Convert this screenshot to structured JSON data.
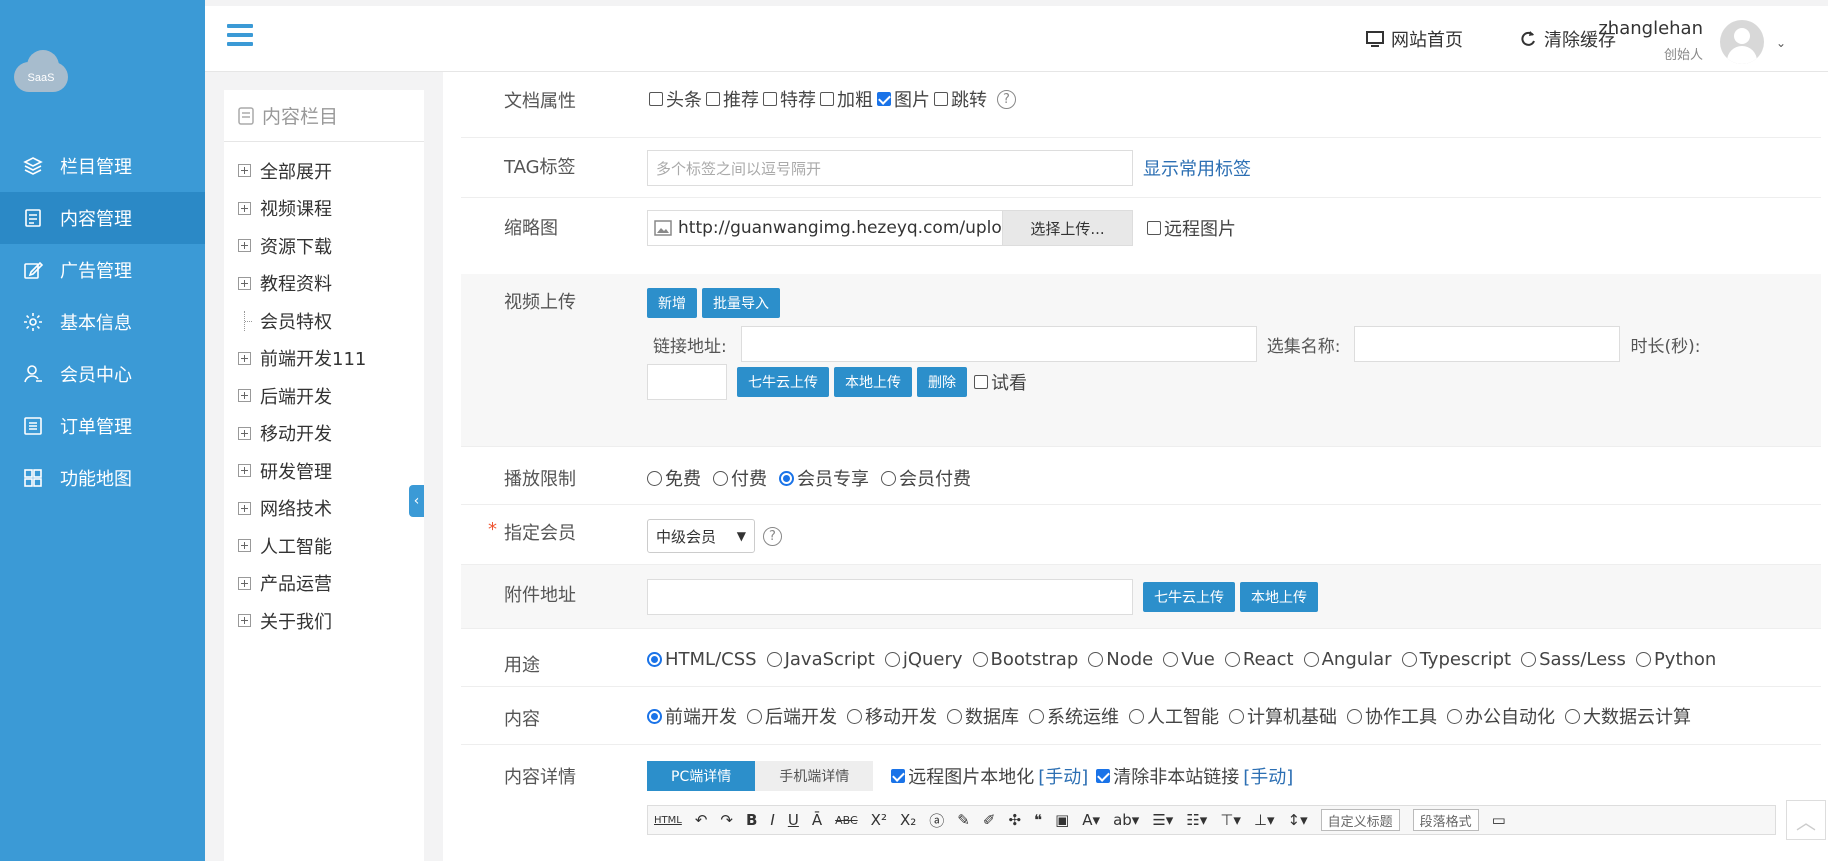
{
  "logo": {
    "text": "SaaS"
  },
  "sidebar": {
    "items": [
      {
        "label": "栏目管理",
        "icon": "layers-icon"
      },
      {
        "label": "内容管理",
        "icon": "document-icon",
        "active": true
      },
      {
        "label": "广告管理",
        "icon": "edit-icon"
      },
      {
        "label": "基本信息",
        "icon": "gear-icon"
      },
      {
        "label": "会员中心",
        "icon": "user-icon"
      },
      {
        "label": "订单管理",
        "icon": "list-icon"
      },
      {
        "label": "功能地图",
        "icon": "grid-icon"
      }
    ]
  },
  "header": {
    "home_link": "网站首页",
    "clear_cache": "清除缓存",
    "user_name": "zhanglehan",
    "user_role": "创始人"
  },
  "tree": {
    "title": "内容栏目",
    "items": [
      {
        "label": "全部展开",
        "type": "plus"
      },
      {
        "label": "视频课程",
        "type": "plus"
      },
      {
        "label": "资源下载",
        "type": "plus"
      },
      {
        "label": "教程资料",
        "type": "plus"
      },
      {
        "label": "会员特权",
        "type": "leaf"
      },
      {
        "label": "前端开发111",
        "type": "plus"
      },
      {
        "label": "后端开发",
        "type": "plus"
      },
      {
        "label": "移动开发",
        "type": "plus"
      },
      {
        "label": "研发管理",
        "type": "plus"
      },
      {
        "label": "网络技术",
        "type": "plus"
      },
      {
        "label": "人工智能",
        "type": "plus"
      },
      {
        "label": "产品运营",
        "type": "plus"
      },
      {
        "label": "关于我们",
        "type": "plus"
      }
    ]
  },
  "form": {
    "doc_attr": {
      "label": "文档属性",
      "options": [
        {
          "label": "头条",
          "checked": false
        },
        {
          "label": "推荐",
          "checked": false
        },
        {
          "label": "特荐",
          "checked": false
        },
        {
          "label": "加粗",
          "checked": false
        },
        {
          "label": "图片",
          "checked": true
        },
        {
          "label": "跳转",
          "checked": false
        }
      ],
      "help": "?"
    },
    "tag": {
      "label": "TAG标签",
      "placeholder": "多个标签之间以逗号隔开",
      "link": "显示常用标签"
    },
    "thumb": {
      "label": "缩略图",
      "value": "http://guanwangimg.hezeyq.com/uploads",
      "button": "选择上传...",
      "remote": "远程图片"
    },
    "video": {
      "label": "视频上传",
      "add": "新增",
      "batch": "批量导入",
      "link_label": "链接地址:",
      "episode_label": "选集名称:",
      "duration_label": "时长(秒):",
      "qiniu": "七牛云上传",
      "local": "本地上传",
      "delete": "删除",
      "trial": "试看"
    },
    "play": {
      "label": "播放限制",
      "options": [
        {
          "label": "免费",
          "checked": false
        },
        {
          "label": "付费",
          "checked": false
        },
        {
          "label": "会员专享",
          "checked": true
        },
        {
          "label": "会员付费",
          "checked": false
        }
      ]
    },
    "member": {
      "required": "*",
      "label": "指定会员",
      "selected": "中级会员",
      "help": "?"
    },
    "attach": {
      "label": "附件地址",
      "qiniu": "七牛云上传",
      "local": "本地上传"
    },
    "usage": {
      "label": "用途",
      "options": [
        {
          "label": "HTML/CSS",
          "checked": true
        },
        {
          "label": "JavaScript",
          "checked": false
        },
        {
          "label": "jQuery",
          "checked": false
        },
        {
          "label": "Bootstrap",
          "checked": false
        },
        {
          "label": "Node",
          "checked": false
        },
        {
          "label": "Vue",
          "checked": false
        },
        {
          "label": "React",
          "checked": false
        },
        {
          "label": "Angular",
          "checked": false
        },
        {
          "label": "Typescript",
          "checked": false
        },
        {
          "label": "Sass/Less",
          "checked": false
        },
        {
          "label": "Python",
          "checked": false
        }
      ]
    },
    "content": {
      "label": "内容",
      "options": [
        {
          "label": "前端开发",
          "checked": true
        },
        {
          "label": "后端开发",
          "checked": false
        },
        {
          "label": "移动开发",
          "checked": false
        },
        {
          "label": "数据库",
          "checked": false
        },
        {
          "label": "系统运维",
          "checked": false
        },
        {
          "label": "人工智能",
          "checked": false
        },
        {
          "label": "计算机基础",
          "checked": false
        },
        {
          "label": "协作工具",
          "checked": false
        },
        {
          "label": "办公自动化",
          "checked": false
        },
        {
          "label": "大数据云计算",
          "checked": false
        }
      ]
    },
    "detail": {
      "label": "内容详情",
      "tab_pc": "PC端详情",
      "tab_mobile": "手机端详情",
      "localize": "远程图片本地化",
      "localize_manual": "[手动]",
      "clean_links": "清除非本站链接",
      "clean_manual": "[手动]",
      "toolbar": {
        "html": "HTML",
        "custom_title": "自定义标题",
        "paragraph": "段落格式"
      }
    }
  }
}
